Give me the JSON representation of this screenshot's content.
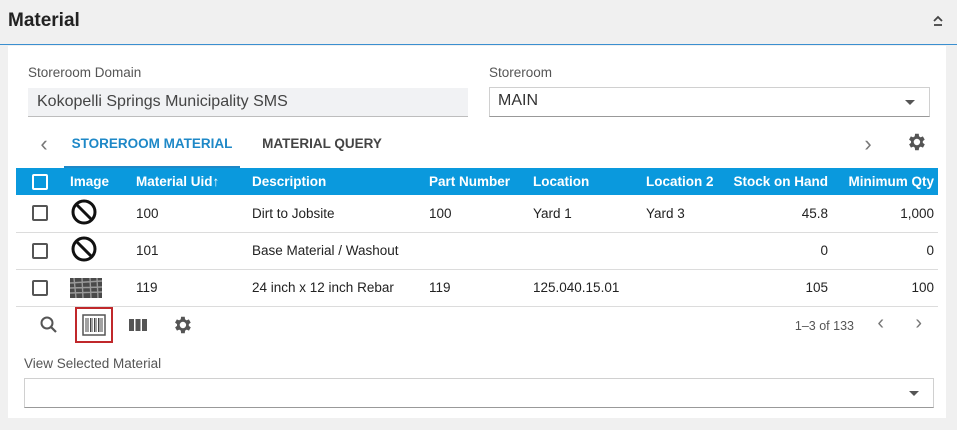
{
  "header": {
    "title": "Material"
  },
  "form": {
    "domain_label": "Storeroom Domain",
    "domain_value": "Kokopelli Springs Municipality SMS",
    "storeroom_label": "Storeroom",
    "storeroom_value": "MAIN"
  },
  "tabs": [
    {
      "label": "STOREROOM MATERIAL",
      "active": true
    },
    {
      "label": "MATERIAL QUERY",
      "active": false
    }
  ],
  "table": {
    "columns": [
      "Image",
      "Material Uid",
      "Description",
      "Part Number",
      "Location",
      "Location 2",
      "Stock on Hand",
      "Minimum Qty"
    ],
    "sort_indicator": "↑",
    "rows": [
      {
        "image": "no-image-icon",
        "uid": "100",
        "description": "Dirt to Jobsite",
        "part": "100",
        "location": "Yard 1",
        "location2": "Yard 3",
        "stock": "45.8",
        "min": "1,000"
      },
      {
        "image": "no-image-icon",
        "uid": "101",
        "description": "Base Material / Washout",
        "part": "",
        "location": "",
        "location2": "",
        "stock": "0",
        "min": "0"
      },
      {
        "image": "rebar-thumbnail",
        "uid": "119",
        "description": "24 inch x 12 inch Rebar",
        "part": "119",
        "location": "125.040.15.01",
        "location2": "",
        "stock": "105",
        "min": "100"
      }
    ]
  },
  "pager": {
    "text": "1–3 of 133"
  },
  "view_selected": {
    "label": "View Selected Material",
    "value": ""
  },
  "colors": {
    "accent": "#1e88c7",
    "header_row": "#0a99dd",
    "selected_outline": "#c0282b"
  }
}
